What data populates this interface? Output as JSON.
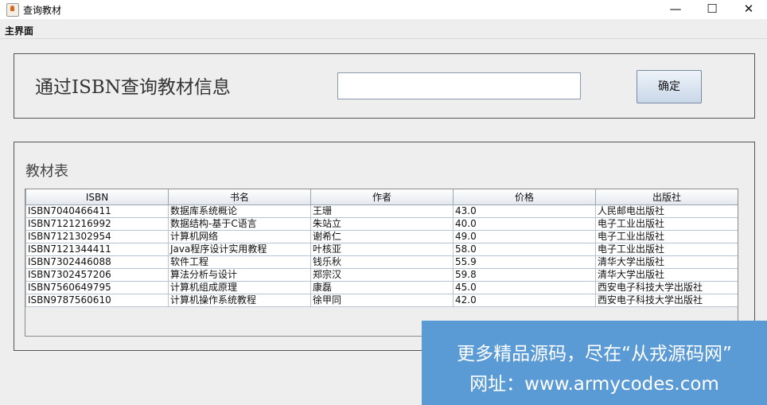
{
  "window": {
    "title": "查询教材",
    "minimize_glyph": "—",
    "maximize_glyph": "☐",
    "close_glyph": "✕"
  },
  "menu": {
    "main": "主界面"
  },
  "search": {
    "label": "通过ISBN查询教材信息",
    "value": "",
    "button_label": "确定"
  },
  "table": {
    "title": "教材表",
    "columns": [
      "ISBN",
      "书名",
      "作者",
      "价格",
      "出版社"
    ],
    "rows": [
      [
        "ISBN7040466411",
        "数据库系统概论",
        "王珊",
        "43.0",
        "人民邮电出版社"
      ],
      [
        "ISBN7121216992",
        "数据结构-基于C语言",
        "朱站立",
        "40.0",
        "电子工业出版社"
      ],
      [
        "ISBN7121302954",
        "计算机网络",
        "谢希仁",
        "49.0",
        "电子工业出版社"
      ],
      [
        "ISBN7121344411",
        "Java程序设计实用教程",
        "叶核亚",
        "58.0",
        "电子工业出版社"
      ],
      [
        "ISBN7302446088",
        "软件工程",
        "钱乐秋",
        "55.9",
        "清华大学出版社"
      ],
      [
        "ISBN7302457206",
        "算法分析与设计",
        "郑宗汉",
        "59.8",
        "清华大学出版社"
      ],
      [
        "ISBN7560649795",
        "计算机组成原理",
        "康磊",
        "45.0",
        "西安电子科技大学出版社"
      ],
      [
        "ISBN9787560610",
        "计算机操作系统教程",
        "徐甲同",
        "42.0",
        "西安电子科技大学出版社"
      ]
    ]
  },
  "watermark": {
    "line1": "更多精品源码，尽在“从戎源码网”",
    "line2": "网址：www.armycodes.com"
  },
  "icons": {
    "app": "java-cup-icon"
  },
  "colors": {
    "watermark_bg": "#5b9bd5",
    "button_gradient_bottom": "#c9d7e8"
  }
}
